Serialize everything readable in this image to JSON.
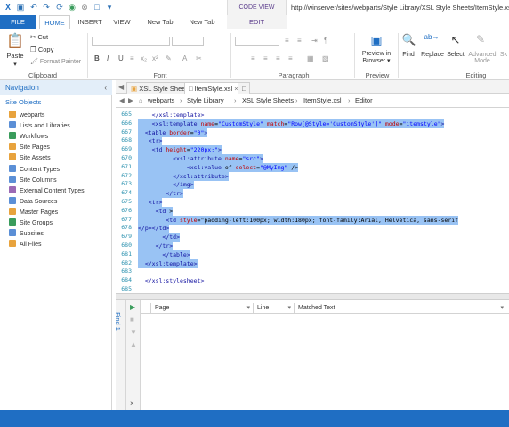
{
  "window": {
    "context_tab_title": "CODE VIEW TOOLS",
    "url": "http://winserver/sites/webparts/Style Library/XSL Style Sheets/ItemStyle.xsl"
  },
  "ribbon_tabs": [
    "FILE",
    "HOME",
    "INSERT",
    "VIEW",
    "New Tab",
    "New Tab",
    "EDIT"
  ],
  "ribbon": {
    "clipboard": {
      "paste": "Paste",
      "cut": "Cut",
      "copy": "Copy",
      "format_painter": "Format Painter",
      "label": "Clipboard"
    },
    "font": {
      "label": "Font",
      "bold": "B",
      "italic": "I",
      "underline": "U"
    },
    "paragraph": {
      "label": "Paragraph"
    },
    "preview": {
      "preview_line1": "Preview in",
      "preview_line2": "Browser",
      "label": "Preview"
    },
    "editing": {
      "find": "Find",
      "replace": "Replace",
      "select": "Select",
      "advanced_line1": "Advanced",
      "advanced_line2": "Mode",
      "sk": "Sk",
      "label": "Editing"
    }
  },
  "navigation": {
    "title": "Navigation",
    "section": "Site Objects",
    "items": [
      {
        "label": "webparts",
        "color": "#e8a33d"
      },
      {
        "label": "Lists and Libraries",
        "color": "#5b8fd6"
      },
      {
        "label": "Workflows",
        "color": "#3a9c5c"
      },
      {
        "label": "Site Pages",
        "color": "#e8a33d"
      },
      {
        "label": "Site Assets",
        "color": "#e8a33d"
      },
      {
        "label": "Content Types",
        "color": "#5b8fd6"
      },
      {
        "label": "Site Columns",
        "color": "#5b8fd6"
      },
      {
        "label": "External Content Types",
        "color": "#9b6ab5"
      },
      {
        "label": "Data Sources",
        "color": "#5b8fd6"
      },
      {
        "label": "Master Pages",
        "color": "#e8a33d"
      },
      {
        "label": "Site Groups",
        "color": "#3a9c5c"
      },
      {
        "label": "Subsites",
        "color": "#5b8fd6"
      },
      {
        "label": "All Files",
        "color": "#e8a33d"
      }
    ]
  },
  "editor_tabs": [
    "XSL Style Sheets",
    "ItemStyle.xsl"
  ],
  "breadcrumb": [
    "webparts",
    "Style Library",
    "XSL Style Sheets",
    "ItemStyle.xsl",
    "Editor"
  ],
  "code_lines": [
    {
      "n": "665",
      "text": "    </xsl:template>",
      "sel": false
    },
    {
      "n": "666",
      "text": "    <xsl:template name=\"CustomStyle\" match=\"Row[@Style='CustomStyle']\" mode=\"itemstyle\">",
      "sel": true
    },
    {
      "n": "667",
      "text": "  <table border=\"0\">",
      "sel": true
    },
    {
      "n": "668",
      "text": "   <tr>",
      "sel": true
    },
    {
      "n": "669",
      "text": "    <td height=\"220px;\">",
      "sel": true
    },
    {
      "n": "670",
      "text": "          <xsl:attribute name=\"src\">",
      "sel": true
    },
    {
      "n": "671",
      "text": "              <xsl:value-of select=\"@MyImg\" />",
      "sel": true
    },
    {
      "n": "672",
      "text": "          </xsl:attribute>",
      "sel": true
    },
    {
      "n": "673",
      "text": "          </img>",
      "sel": true
    },
    {
      "n": "674",
      "text": "        </tr>",
      "sel": true
    },
    {
      "n": "675",
      "text": "   <tr>",
      "sel": true
    },
    {
      "n": "676",
      "text": "     <td >",
      "sel": true
    },
    {
      "n": "677",
      "text": "        <td style=\"padding-left:100px; width:180px; font-family:Arial, Helvetica, sans-serif",
      "sel": true
    },
    {
      "n": "678",
      "text": "</p></td>",
      "sel": true
    },
    {
      "n": "679",
      "text": "       </td>",
      "sel": true
    },
    {
      "n": "680",
      "text": "     </tr>",
      "sel": true
    },
    {
      "n": "681",
      "text": "       </table>",
      "sel": true
    },
    {
      "n": "682",
      "text": "  </xsl:template>",
      "sel": true
    },
    {
      "n": "683",
      "text": "",
      "sel": false
    },
    {
      "n": "684",
      "text": "  </xsl:stylesheet>",
      "sel": false
    },
    {
      "n": "685",
      "text": "",
      "sel": false
    }
  ],
  "find_panel": {
    "title": "Find 1",
    "columns": [
      "Page",
      "Line",
      "Matched Text"
    ]
  }
}
